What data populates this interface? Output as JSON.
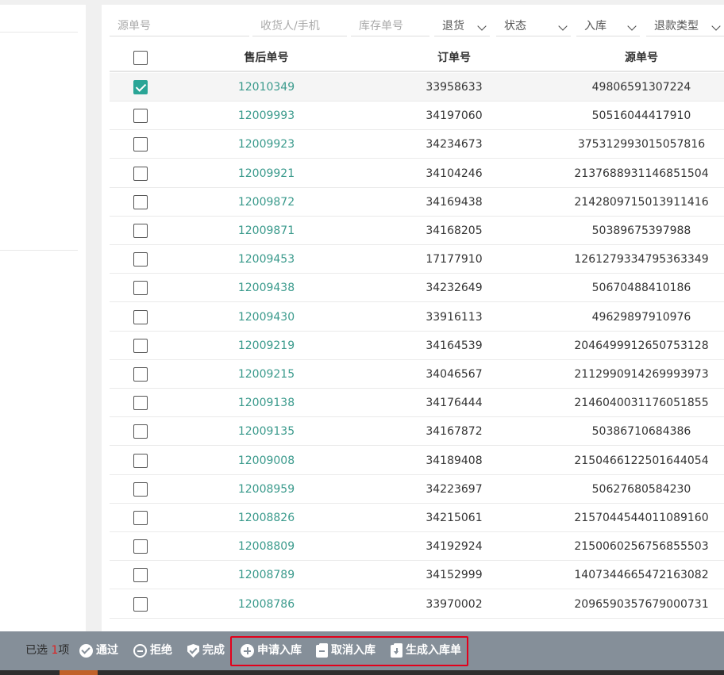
{
  "filters": [
    {
      "placeholder": "源单号",
      "type": "input"
    },
    {
      "placeholder": "收货人/手机",
      "type": "input"
    },
    {
      "placeholder": "库存单号",
      "type": "input"
    },
    {
      "value": "退货",
      "type": "select"
    },
    {
      "value": "状态",
      "type": "select"
    },
    {
      "value": "入库",
      "type": "select"
    },
    {
      "value": "退款类型",
      "type": "select"
    }
  ],
  "table": {
    "headers": [
      "售后单号",
      "订单号",
      "源单号"
    ],
    "rows": [
      {
        "after_sale_no": "12010349",
        "order_no": "33958633",
        "source_no": "49806591307224",
        "checked": true
      },
      {
        "after_sale_no": "12009993",
        "order_no": "34197060",
        "source_no": "50516044417910",
        "checked": false
      },
      {
        "after_sale_no": "12009923",
        "order_no": "34234673",
        "source_no": "375312993015057816",
        "checked": false
      },
      {
        "after_sale_no": "12009921",
        "order_no": "34104246",
        "source_no": "2137688931146851504",
        "checked": false
      },
      {
        "after_sale_no": "12009872",
        "order_no": "34169438",
        "source_no": "2142809715013911416",
        "checked": false
      },
      {
        "after_sale_no": "12009871",
        "order_no": "34168205",
        "source_no": "50389675397988",
        "checked": false
      },
      {
        "after_sale_no": "12009453",
        "order_no": "17177910",
        "source_no": "1261279334795363349",
        "checked": false
      },
      {
        "after_sale_no": "12009438",
        "order_no": "34232649",
        "source_no": "50670488410186",
        "checked": false
      },
      {
        "after_sale_no": "12009430",
        "order_no": "33916113",
        "source_no": "49629897910976",
        "checked": false
      },
      {
        "after_sale_no": "12009219",
        "order_no": "34164539",
        "source_no": "2046499912650753128",
        "checked": false
      },
      {
        "after_sale_no": "12009215",
        "order_no": "34046567",
        "source_no": "2112990914269993973",
        "checked": false
      },
      {
        "after_sale_no": "12009138",
        "order_no": "34176444",
        "source_no": "2146040031176051855",
        "checked": false
      },
      {
        "after_sale_no": "12009135",
        "order_no": "34167872",
        "source_no": "50386710684386",
        "checked": false
      },
      {
        "after_sale_no": "12009008",
        "order_no": "34189408",
        "source_no": "2150466122501644054",
        "checked": false
      },
      {
        "after_sale_no": "12008959",
        "order_no": "34223697",
        "source_no": "50627680584230",
        "checked": false
      },
      {
        "after_sale_no": "12008826",
        "order_no": "34215061",
        "source_no": "2157044544011089160",
        "checked": false
      },
      {
        "after_sale_no": "12008809",
        "order_no": "34192924",
        "source_no": "2150060256756855503",
        "checked": false
      },
      {
        "after_sale_no": "12008789",
        "order_no": "34152999",
        "source_no": "1407344665472163082",
        "checked": false
      },
      {
        "after_sale_no": "12008786",
        "order_no": "33970002",
        "source_no": "2096590357679000731",
        "checked": false
      }
    ]
  },
  "bottom_bar": {
    "selected_prefix": "已选",
    "selected_count": "1",
    "selected_suffix": "项",
    "actions": [
      {
        "label": "通过",
        "icon": "check-circle-icon"
      },
      {
        "label": "拒绝",
        "icon": "minus-circle-icon"
      },
      {
        "label": "完成",
        "icon": "shield-check-icon"
      },
      {
        "label": "申请入库",
        "icon": "plus-circle-icon"
      },
      {
        "label": "取消入库",
        "icon": "box-minus-icon"
      },
      {
        "label": "生成入库单",
        "icon": "box-download-icon"
      }
    ]
  },
  "colors": {
    "link": "#3a9a8c",
    "checkbox_checked": "#2aa596",
    "bottom_bar": "#858f99",
    "highlight": "#e3001b",
    "count": "#e02020"
  }
}
